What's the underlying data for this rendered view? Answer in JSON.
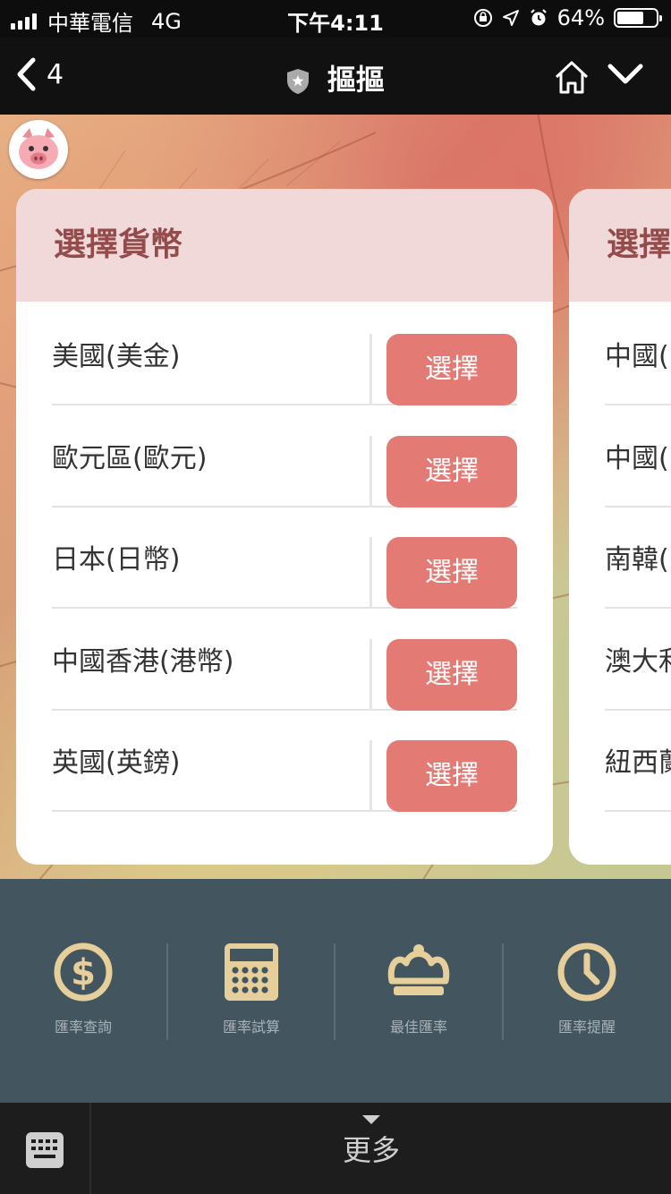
{
  "status": {
    "carrier": "中華電信",
    "network": "4G",
    "time": "下午4:11",
    "battery": "64%",
    "battery_level": 0.64
  },
  "nav": {
    "back_count": "4",
    "title": "摳摳"
  },
  "card": {
    "header": "選擇貨幣",
    "button_label": "選擇",
    "items": [
      "美國(美金)",
      "歐元區(歐元)",
      "日本(日幣)",
      "中國香港(港幣)",
      "英國(英鎊)"
    ]
  },
  "next_card": {
    "header": "選擇",
    "items": [
      "中國(",
      "中國(",
      "南韓(",
      "澳大利",
      "紐西蘭"
    ]
  },
  "tabs": [
    {
      "label": "匯率查詢",
      "icon": "dollar-icon"
    },
    {
      "label": "匯率試算",
      "icon": "calculator-icon"
    },
    {
      "label": "最佳匯率",
      "icon": "crown-icon"
    },
    {
      "label": "匯率提醒",
      "icon": "clock-icon"
    }
  ],
  "bottom": {
    "more_label": "更多"
  },
  "colors": {
    "accent": "#e47a74",
    "header_bg": "#f1d9da",
    "header_text": "#944b4b",
    "tabbar": "#435660",
    "icon_gold": "#e7cf9b"
  }
}
